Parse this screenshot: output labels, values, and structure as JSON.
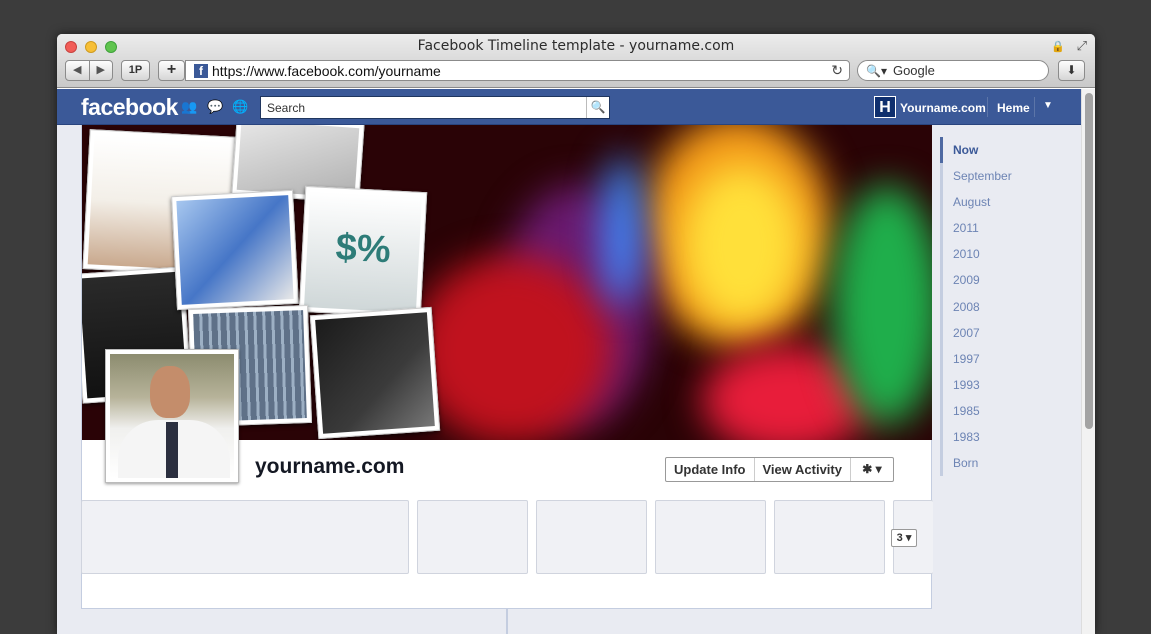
{
  "window": {
    "title": "Facebook Timeline template - yourname.com"
  },
  "toolbar": {
    "back": "◀",
    "forward": "▶",
    "reader_label": "1P",
    "add_label": "+",
    "url": "https://www.facebook.com/yourname",
    "search_value": "Google"
  },
  "fb": {
    "logo": "facebook",
    "search_placeholder": "Search",
    "avatar_letter": "H",
    "user_name": "Yourname.com",
    "home_label": "Heme"
  },
  "profile": {
    "name": "yourname.com",
    "update_info": "Update Info",
    "view_activity": "View Activity",
    "gear": "✱ ▾"
  },
  "apps": {
    "count_label": "3 ▾"
  },
  "scrubber": {
    "items": [
      "Now",
      "September",
      "August",
      "2011",
      "2010",
      "2009",
      "2008",
      "2007",
      "1997",
      "1993",
      "1985",
      "1983",
      "Born"
    ]
  },
  "colors": {
    "fb_blue": "#3b5998",
    "scrubber_text": "#6d84b4"
  }
}
